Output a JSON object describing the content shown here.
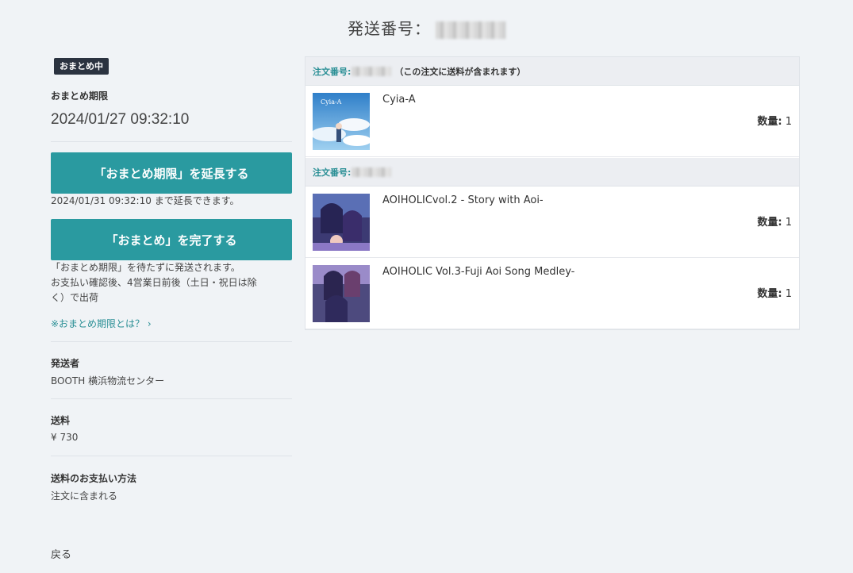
{
  "header": {
    "title": "発送番号："
  },
  "left": {
    "badge": "おまとめ中",
    "deadline_label": "おまとめ期限",
    "deadline_value": "2024/01/27 09:32:10",
    "extend_button": "「おまとめ期限」を延長する",
    "extend_note": "2024/01/31 09:32:10 まで延長できます。",
    "complete_button": "「おまとめ」を完了する",
    "complete_note_1": "「おまとめ期限」を待たずに発送されます。",
    "complete_note_2": "お支払い確認後、4営業日前後（土日・祝日は除",
    "complete_note_3": "く）で出荷",
    "info_link": "※おまとめ期限とは？ ›",
    "sender_label": "発送者",
    "sender_value": "BOOTH 横浜物流センター",
    "shipping_label": "送料",
    "shipping_value": "¥ 730",
    "payment_label": "送料のお支払い方法",
    "payment_value": "注文に含まれる",
    "back_link": "戻る"
  },
  "orders": [
    {
      "label": "注文番号:",
      "note": "（この注文に送料が含まれます）",
      "items": [
        {
          "name": "Cyia-A",
          "qty_label": "数量:",
          "qty": "1"
        }
      ]
    },
    {
      "label": "注文番号:",
      "note": "",
      "items": [
        {
          "name": "AOIHOLICvol.2 - Story with Aoi-",
          "qty_label": "数量:",
          "qty": "1"
        },
        {
          "name": "AOIHOLIC Vol.3-Fuji Aoi Song Medley-",
          "qty_label": "数量:",
          "qty": "1"
        }
      ]
    }
  ],
  "colors": {
    "accent": "#2a9aa0",
    "link": "#2a8f95",
    "badge": "#2b3340",
    "background": "#f0f3f6"
  }
}
